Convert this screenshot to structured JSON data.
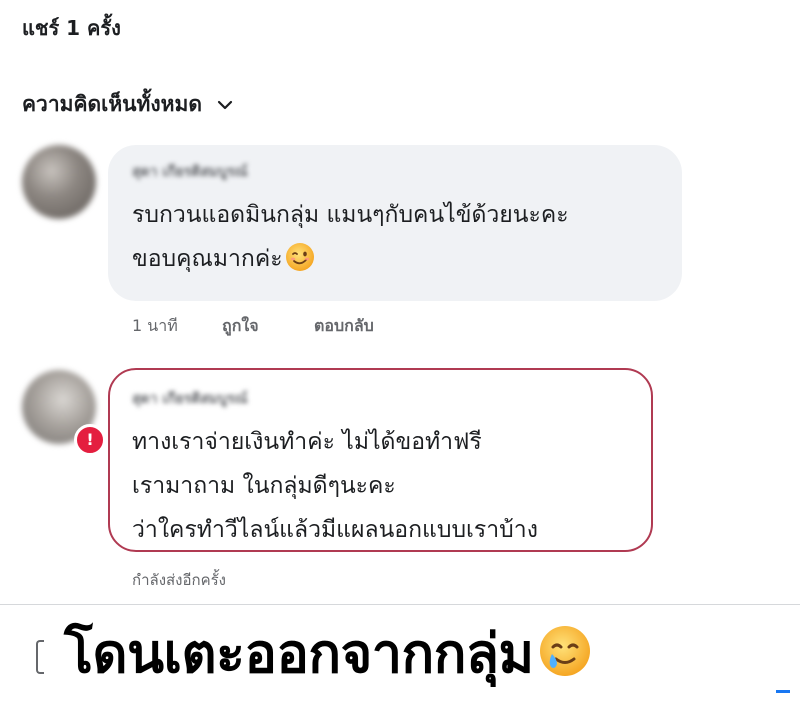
{
  "header": {
    "share_count": "แชร์ 1 ครั้ง",
    "sort_label": "ความคิดเห็นทั้งหมด",
    "sort_icon": "chevron-down-icon"
  },
  "comments": [
    {
      "author_blurred": "สุดา เกียรติสมบูรณ์",
      "text": "รบกวนแอดมินกลุ่ม แมนๆกับคนไข้ด้วยนะคะ\nขอบคุณมากค่ะ",
      "emoji": "winking-face-icon",
      "time": "1 นาที",
      "like_label": "ถูกใจ",
      "reply_label": "ตอบกลับ",
      "bubble_color": "#f0f2f5"
    },
    {
      "author_blurred": "สุดา เกียรติสมบูรณ์",
      "text": "ทางเราจ่ายเงินทำค่ะ ไม่ได้ขอทำฟรี\nเรามาถาม ในกลุ่มดีๆนะคะ\nว่าใครทำวีไลน์แล้วมีแผลนอกแบบเราบ้าง",
      "status": "กำลังส่งอีกครั้ง",
      "alert_icon": "error-alert-icon",
      "border_color": "#b03a52"
    }
  ],
  "caption": {
    "text": "โดนเตะออกจากกลุ่ม",
    "emoji": "smiling-face-with-tear-icon"
  },
  "colors": {
    "secondary_text": "#65676b",
    "alert": "#e41e3f",
    "accent": "#1877f2"
  }
}
